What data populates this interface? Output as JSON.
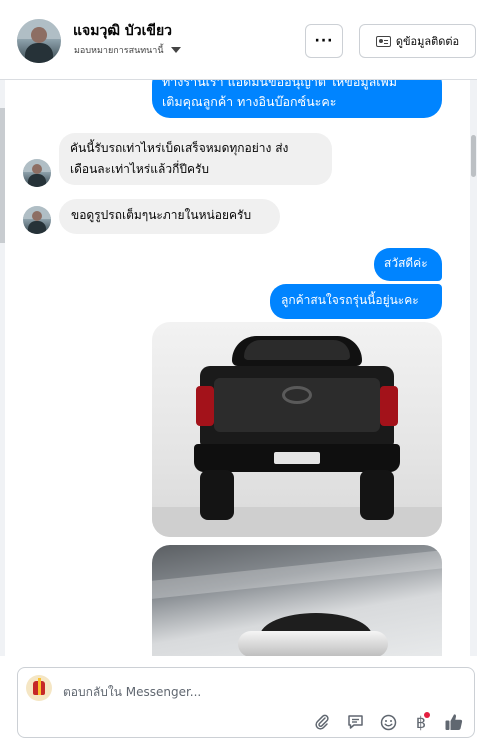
{
  "header": {
    "contact_name": "แจมวุฒิ บัวเขียว",
    "contact_subtitle": "มอบหมายการสนทนานี้",
    "more_label": "···",
    "contact_info_label": "ดูข้อมูลติดต่อ"
  },
  "messages": [
    {
      "direction": "outgoing",
      "lines": [
        "ทางร้านเรา แอดมินขออนุญาต ให้ข้อมูลเพิ่ม",
        "เติมคุณลูกค้า ทางอินบ๊อกซ์นะคะ"
      ]
    },
    {
      "direction": "incoming",
      "lines": [
        "คันนี้รับรถเท่าไหร่เบ็ดเสร็จหมดทุกอย่าง ส่ง",
        "เดือนละเท่าไหร่แล้วกี่ปีครับ"
      ]
    },
    {
      "direction": "incoming",
      "lines": [
        "ขอดูรูปรถเต็มๆนะภายในหน่อยครับ"
      ]
    },
    {
      "direction": "outgoing",
      "lines": [
        "สวัสดีค่ะ"
      ]
    },
    {
      "direction": "outgoing",
      "lines": [
        "ลูกค้าสนใจรถรุ่นนี้อยู่นะคะ"
      ]
    }
  ],
  "attachments": [
    {
      "type": "photo",
      "subject": "pickup-truck-rear"
    },
    {
      "type": "photo",
      "subject": "door-handle-closeup"
    }
  ],
  "composer": {
    "placeholder": "ตอบกลับใน Messenger..."
  },
  "icons": [
    "paperclip-icon",
    "saved-reply-icon",
    "emoji-icon",
    "baht-payment-icon",
    "thumbs-up-icon"
  ],
  "colors": {
    "outgoing_bubble": "#0084ff",
    "incoming_bubble": "#f0f0f0",
    "like_button": "#606770",
    "notification_dot": "#e41e3f"
  }
}
